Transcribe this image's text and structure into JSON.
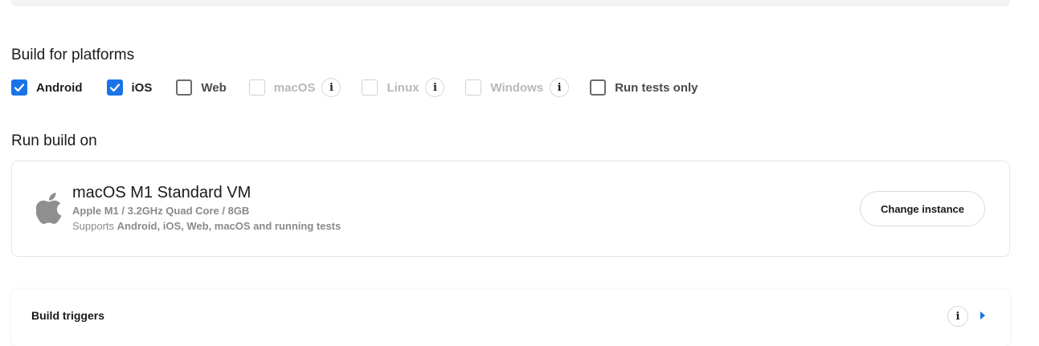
{
  "build_for": {
    "title": "Build for platforms",
    "platforms": [
      {
        "label": "Android",
        "checked": true,
        "disabled": false,
        "info": false
      },
      {
        "label": "iOS",
        "checked": true,
        "disabled": false,
        "info": false
      },
      {
        "label": "Web",
        "checked": false,
        "disabled": false,
        "info": false
      },
      {
        "label": "macOS",
        "checked": false,
        "disabled": true,
        "info": true
      },
      {
        "label": "Linux",
        "checked": false,
        "disabled": true,
        "info": true
      },
      {
        "label": "Windows",
        "checked": false,
        "disabled": true,
        "info": true
      },
      {
        "label": "Run tests only",
        "checked": false,
        "disabled": false,
        "info": false
      }
    ],
    "info_glyph": "i"
  },
  "run_build_on": {
    "title": "Run build on",
    "instance": {
      "icon": "apple-icon",
      "name": "macOS M1 Standard VM",
      "spec": "Apple M1 / 3.2GHz Quad Core / 8GB",
      "supports_prefix": "Supports",
      "supports_list": "Android, iOS, Web, macOS and running tests",
      "change_label": "Change instance"
    }
  },
  "build_triggers": {
    "title": "Build triggers",
    "info_glyph": "i"
  },
  "colors": {
    "accent": "#1a73e8",
    "disabled_text": "#b8b8b8",
    "muted_text": "#8a8a8a"
  }
}
